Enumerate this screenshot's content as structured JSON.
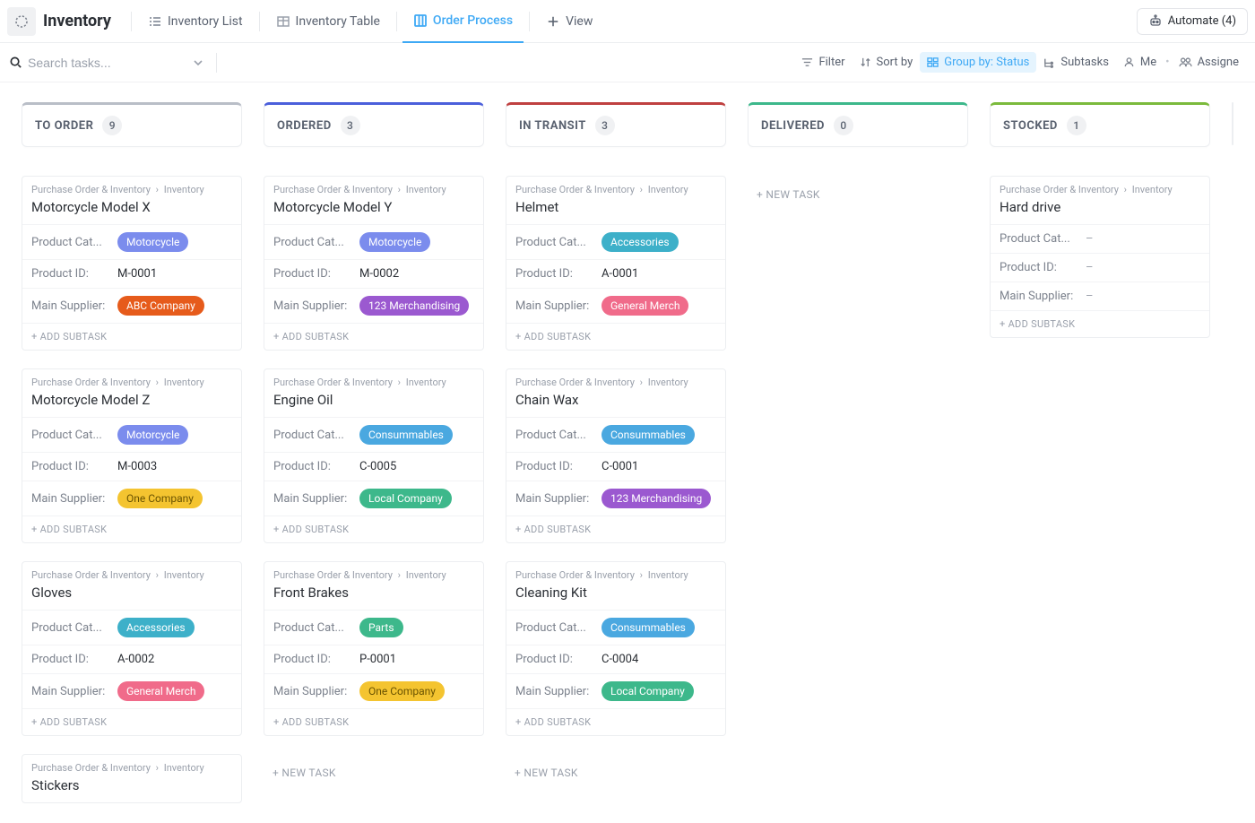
{
  "header": {
    "app_title": "Inventory",
    "tabs": [
      {
        "label": "Inventory List"
      },
      {
        "label": "Inventory Table"
      },
      {
        "label": "Order Process"
      }
    ],
    "add_view": "View",
    "automate": "Automate (4)"
  },
  "toolbar": {
    "search_placeholder": "Search tasks...",
    "filter": "Filter",
    "sort": "Sort by",
    "group": "Group by: Status",
    "subtasks": "Subtasks",
    "me": "Me",
    "assignee": "Assigne"
  },
  "breadcrumb": {
    "a": "Purchase Order & Inventory",
    "b": "Inventory"
  },
  "labels": {
    "product_cat": "Product Cat...",
    "product_id": "Product ID:",
    "main_supplier": "Main Supplier:",
    "add_subtask": "+ ADD SUBTASK",
    "new_task": "+ NEW TASK"
  },
  "columns": [
    {
      "key": "toorder",
      "title": "TO ORDER",
      "count": "9",
      "cards": [
        {
          "title": "Motorcycle Model X",
          "cat": "Motorcycle",
          "cat_color": "motorcycle",
          "pid": "M-0001",
          "supplier": "ABC Company",
          "sup_color": "abc"
        },
        {
          "title": "Motorcycle Model Z",
          "cat": "Motorcycle",
          "cat_color": "motorcycle",
          "pid": "M-0003",
          "supplier": "One Company",
          "sup_color": "one"
        },
        {
          "title": "Gloves",
          "cat": "Accessories",
          "cat_color": "accessories",
          "pid": "A-0002",
          "supplier": "General Merch",
          "sup_color": "general"
        },
        {
          "title": "Stickers",
          "partial": true
        }
      ]
    },
    {
      "key": "ordered",
      "title": "ORDERED",
      "count": "3",
      "cards": [
        {
          "title": "Motorcycle Model Y",
          "cat": "Motorcycle",
          "cat_color": "motorcycle",
          "pid": "M-0002",
          "supplier": "123 Merchandising",
          "sup_color": "123m"
        },
        {
          "title": "Engine Oil",
          "cat": "Consummables",
          "cat_color": "consumables",
          "pid": "C-0005",
          "supplier": "Local Company",
          "sup_color": "local"
        },
        {
          "title": "Front Brakes",
          "cat": "Parts",
          "cat_color": "parts",
          "pid": "P-0001",
          "supplier": "One Company",
          "sup_color": "one"
        }
      ],
      "show_new_task": true
    },
    {
      "key": "intransit",
      "title": "IN TRANSIT",
      "count": "3",
      "cards": [
        {
          "title": "Helmet",
          "cat": "Accessories",
          "cat_color": "accessories",
          "pid": "A-0001",
          "supplier": "General Merch",
          "sup_color": "general"
        },
        {
          "title": "Chain Wax",
          "cat": "Consummables",
          "cat_color": "consumables",
          "pid": "C-0001",
          "supplier": "123 Merchandising",
          "sup_color": "123m"
        },
        {
          "title": "Cleaning Kit",
          "cat": "Consummables",
          "cat_color": "consumables",
          "pid": "C-0004",
          "supplier": "Local Company",
          "sup_color": "local"
        }
      ],
      "show_new_task": true
    },
    {
      "key": "delivered",
      "title": "DELIVERED",
      "count": "0",
      "cards": [],
      "empty_new_task": true
    },
    {
      "key": "stocked",
      "title": "STOCKED",
      "count": "1",
      "cards": [
        {
          "title": "Hard drive",
          "cat": null,
          "pid": null,
          "supplier": null
        }
      ]
    }
  ]
}
